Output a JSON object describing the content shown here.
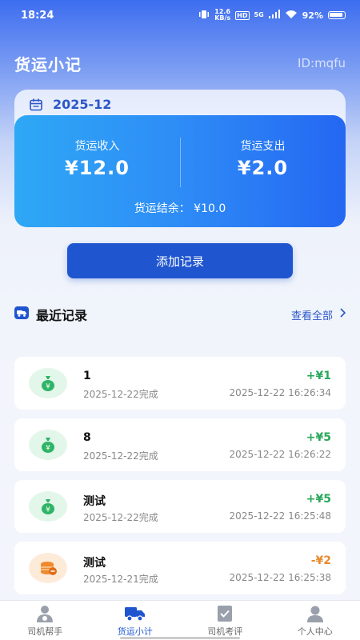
{
  "status": {
    "time": "18:24",
    "speed_value": "12.6",
    "speed_unit": "KB/s",
    "hd": "HD",
    "net": "5G",
    "battery": "92%"
  },
  "header": {
    "title": "货运小记",
    "user_id": "ID:mqfu"
  },
  "month": {
    "label": "2025-12"
  },
  "summary": {
    "income_label": "货运收入",
    "income_value": "¥12.0",
    "expense_label": "货运支出",
    "expense_value": "¥2.0",
    "balance_label": "货运结余：",
    "balance_value": "¥10.0"
  },
  "actions": {
    "add_label": "添加记录"
  },
  "recent": {
    "title": "最近记录",
    "view_all": "查看全部"
  },
  "records": [
    {
      "title": "1",
      "sub": "2025-12-22完成",
      "amount": "+¥1",
      "time": "2025-12-22 16:26:34",
      "kind": "income",
      "icon": "money-bag-icon"
    },
    {
      "title": "8",
      "sub": "2025-12-22完成",
      "amount": "+¥5",
      "time": "2025-12-22 16:26:22",
      "kind": "income",
      "icon": "money-bag-icon"
    },
    {
      "title": "测试",
      "sub": "2025-12-22完成",
      "amount": "+¥5",
      "time": "2025-12-22 16:25:48",
      "kind": "income",
      "icon": "money-bag-icon"
    },
    {
      "title": "测试",
      "sub": "2025-12-21完成",
      "amount": "-¥2",
      "time": "2025-12-22 16:25:38",
      "kind": "expense",
      "icon": "coin-stack-icon"
    }
  ],
  "tabs": [
    {
      "label": "司机帮手",
      "icon": "driver-icon",
      "active": false
    },
    {
      "label": "货运小计",
      "icon": "truck-icon",
      "active": true
    },
    {
      "label": "司机考评",
      "icon": "review-icon",
      "active": false
    },
    {
      "label": "个人中心",
      "icon": "person-icon",
      "active": false
    }
  ],
  "colors": {
    "accent": "#1f55cf",
    "income": "#29a85b",
    "expense": "#e98a2f"
  }
}
